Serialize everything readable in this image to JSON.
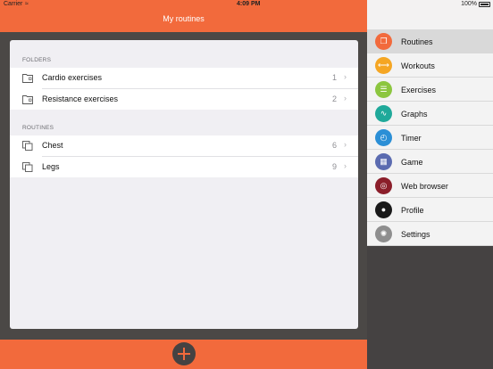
{
  "status": {
    "carrier": "Carrier",
    "wifi": "≈",
    "time": "4:09 PM",
    "battery": "100%"
  },
  "navbar": {
    "title": "My routines"
  },
  "sections": {
    "folders_header": "FOLDERS",
    "routines_header": "ROUTINES"
  },
  "folders": [
    {
      "label": "Cardio exercises",
      "count": "1"
    },
    {
      "label": "Resistance exercises",
      "count": "2"
    }
  ],
  "routines": [
    {
      "label": "Chest",
      "count": "6"
    },
    {
      "label": "Legs",
      "count": "9"
    }
  ],
  "chevron": "›",
  "menu": [
    {
      "label": "Routines",
      "color": "#f26a3c",
      "icon": "copy-icon",
      "glyph": "❐"
    },
    {
      "label": "Workouts",
      "color": "#f5a623",
      "icon": "dumbbell-icon",
      "glyph": "⟷"
    },
    {
      "label": "Exercises",
      "color": "#8cc63f",
      "icon": "list-icon",
      "glyph": "☰"
    },
    {
      "label": "Graphs",
      "color": "#1fa99a",
      "icon": "graph-icon",
      "glyph": "∿"
    },
    {
      "label": "Timer",
      "color": "#2b8fd6",
      "icon": "timer-icon",
      "glyph": "◴"
    },
    {
      "label": "Game",
      "color": "#5b6bb0",
      "icon": "game-icon",
      "glyph": "▦"
    },
    {
      "label": "Web browser",
      "color": "#8b1e2a",
      "icon": "compass-icon",
      "glyph": "◎"
    },
    {
      "label": "Profile",
      "color": "#1a1a1a",
      "icon": "profile-icon",
      "glyph": "●"
    },
    {
      "label": "Settings",
      "color": "#8e8e8e",
      "icon": "gear-icon",
      "glyph": "✺"
    }
  ]
}
